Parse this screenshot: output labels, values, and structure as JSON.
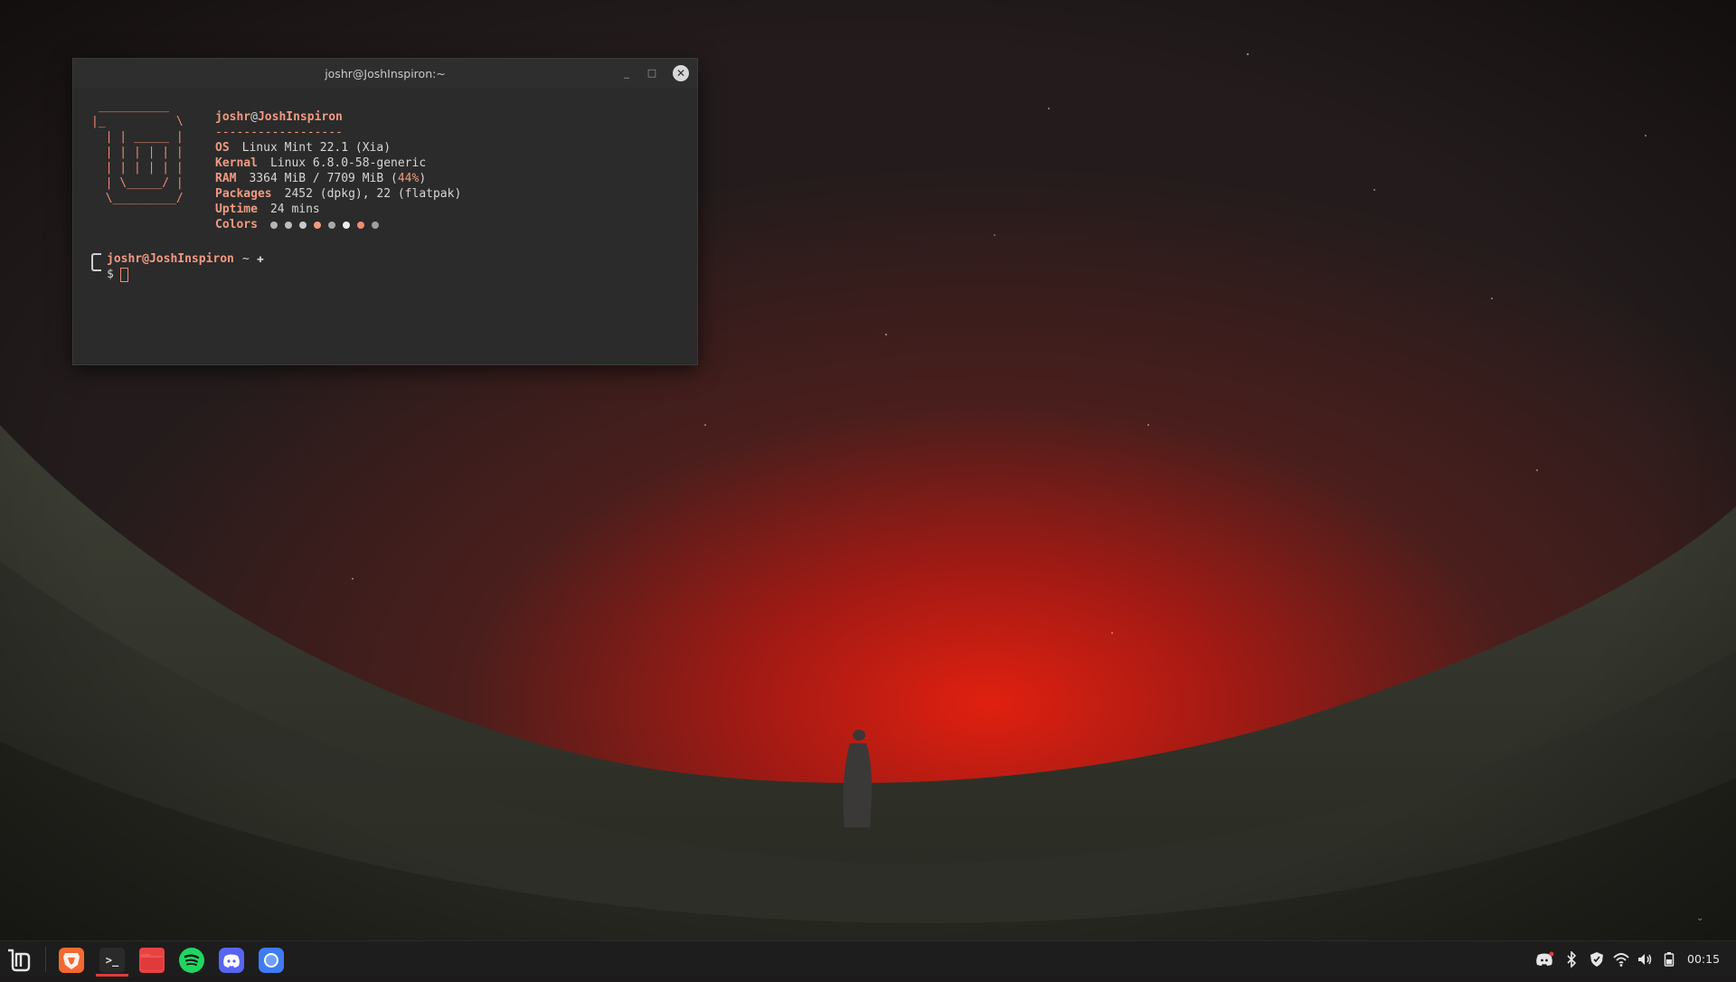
{
  "terminal": {
    "title": "joshr@JoshInspiron:~",
    "logo": [
      " __________",
      "|_          \\",
      "  | | _____ |",
      "  | | | | | |",
      "  | | | | | |",
      "  | \\_____/ |",
      "  \\_________/"
    ],
    "fetch": {
      "user": "joshr",
      "at": "@",
      "host": "JoshInspiron",
      "separator": "------------------",
      "os_label": "OS",
      "os_value": "Linux Mint 22.1 (Xia)",
      "kernel_label": "Kernal",
      "kernel_value": "Linux 6.8.0-58-generic",
      "ram_label": "RAM",
      "ram_value": "3364 MiB / 7709 MiB (",
      "ram_percent": "44%",
      "ram_close": ")",
      "packages_label": "Packages",
      "packages_value": "2452 (dpkg), 22 (flatpak)",
      "uptime_label": "Uptime",
      "uptime_value": "24 mins",
      "colors_label": "Colors",
      "color_swatches": [
        "#b5b5b5",
        "#bdbdbd",
        "#c9c9c9",
        "#f09a7e",
        "#a8a8a8",
        "#ededed",
        "#f08b74",
        "#9e9e9e"
      ]
    },
    "prompt": {
      "user_host": "joshr@JoshInspiron",
      "path": "~",
      "glyph": "✚",
      "symbol": "$"
    }
  },
  "taskbar": {
    "menu_icon": "linux-mint-logo-icon",
    "apps": [
      {
        "name": "brave-browser-icon",
        "glyph": "B"
      },
      {
        "name": "terminal-icon",
        "glyph": ">_"
      },
      {
        "name": "files-icon",
        "glyph": ""
      },
      {
        "name": "spotify-icon",
        "glyph": "≋"
      },
      {
        "name": "discord-icon",
        "glyph": "◕"
      },
      {
        "name": "chat-app-icon",
        "glyph": "●"
      }
    ],
    "tray_icons": [
      "discord-tray-icon",
      "bluetooth-icon",
      "shield-icon",
      "wifi-icon",
      "volume-icon",
      "battery-icon"
    ],
    "clock": "00:15"
  },
  "colors": {
    "accent": "#f29a82",
    "active_indicator": "#e33c3c"
  }
}
